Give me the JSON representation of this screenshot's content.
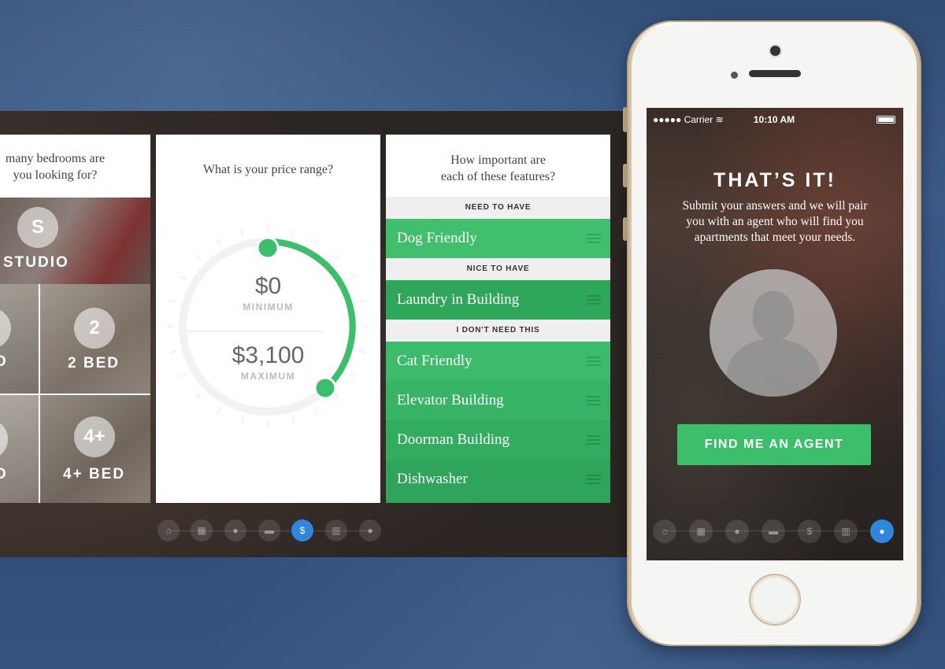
{
  "bedrooms_screen": {
    "question_line1": "many bedrooms are",
    "question_line2": "you looking for?",
    "tiles": [
      {
        "bubble": "S",
        "label": "STUDIO"
      },
      {
        "bubble": "",
        "label": "D"
      },
      {
        "bubble": "2",
        "label": "2 BED"
      },
      {
        "bubble": "",
        "label": "D"
      },
      {
        "bubble": "4+",
        "label": "4+ BED"
      }
    ]
  },
  "price_screen": {
    "question": "What is your price range?",
    "minimum_value": "$0",
    "minimum_label": "MINIMUM",
    "maximum_value": "$3,100",
    "maximum_label": "MAXIMUM",
    "accent_color": "#3bbf6b"
  },
  "features_screen": {
    "question_line1": "How important are",
    "question_line2": "each of these features?",
    "sections": [
      {
        "header": "NEED TO HAVE",
        "items": [
          "Dog Friendly"
        ]
      },
      {
        "header": "NICE TO HAVE",
        "items": [
          "Laundry in Building"
        ]
      },
      {
        "header": "I DON'T NEED THIS",
        "items": [
          "Cat Friendly",
          "Elevator Building",
          "Doorman Building",
          "Dishwasher"
        ]
      }
    ]
  },
  "pager": {
    "icons": [
      "home-icon",
      "calendar-icon",
      "location-pin-icon",
      "bed-icon",
      "dollar-icon",
      "building-icon",
      "user-icon"
    ],
    "glyphs": [
      "⌂",
      "▦",
      "●",
      "▬",
      "$",
      "▥",
      "●"
    ],
    "strip_active": "dollar-icon",
    "phone_active": "user-icon",
    "active_color": "#2f86de"
  },
  "phone": {
    "status": {
      "carrier": "●●●●● Carrier ≋",
      "time": "10:10 AM"
    },
    "title": "THAT’S IT!",
    "subtitle_line1": "Submit your answers and we will pair",
    "subtitle_line2": "you with an agent who will find you",
    "subtitle_line3": "apartments that meet your needs.",
    "button_label": "FIND ME AN AGENT",
    "button_color": "#3bbf6b"
  }
}
